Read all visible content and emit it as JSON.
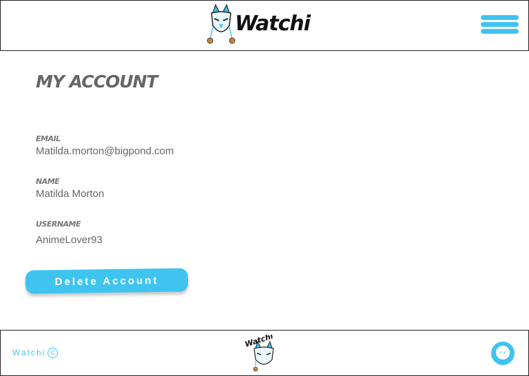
{
  "header": {
    "brand": "Watchi",
    "menu_icon": "hamburger-menu-icon"
  },
  "page": {
    "title": "My Account"
  },
  "account": {
    "email_label": "Email",
    "email_value": "Matilda.morton@bigpond.com",
    "name_label": "Name",
    "name_value": "Matilda Morton",
    "username_label": "Username",
    "username_value": "AnimeLover93"
  },
  "actions": {
    "delete_label": "Delete Account"
  },
  "footer": {
    "brand": "Watchi",
    "copyright_symbol": "C",
    "chat_icon": "messenger-icon"
  },
  "colors": {
    "accent": "#3fc4f0",
    "text": "#666666",
    "border": "#222222"
  }
}
